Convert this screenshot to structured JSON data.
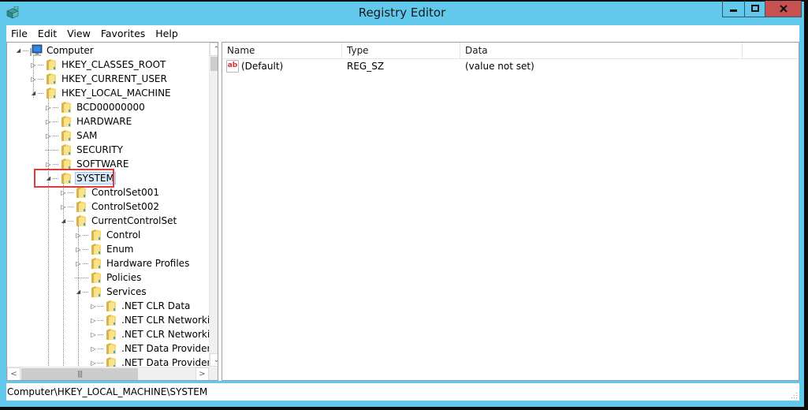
{
  "window": {
    "title": "Registry Editor",
    "accent_color": "#62c9ec",
    "close_color": "#c75050",
    "buttons": {
      "minimize": "minimize-icon",
      "maximize": "maximize-icon",
      "close": "close-icon"
    }
  },
  "menu": {
    "items": [
      {
        "label": "File"
      },
      {
        "label": "Edit"
      },
      {
        "label": "View"
      },
      {
        "label": "Favorites"
      },
      {
        "label": "Help"
      }
    ]
  },
  "tree": {
    "nodes": [
      {
        "label": "Computer",
        "level": 0,
        "expander": "expanded",
        "icon": "computer-icon"
      },
      {
        "label": "HKEY_CLASSES_ROOT",
        "level": 1,
        "expander": "collapsed",
        "icon": "folder-icon"
      },
      {
        "label": "HKEY_CURRENT_USER",
        "level": 1,
        "expander": "collapsed",
        "icon": "folder-icon"
      },
      {
        "label": "HKEY_LOCAL_MACHINE",
        "level": 1,
        "expander": "expanded",
        "icon": "folder-icon"
      },
      {
        "label": "BCD00000000",
        "level": 2,
        "expander": "collapsed",
        "icon": "folder-icon"
      },
      {
        "label": "HARDWARE",
        "level": 2,
        "expander": "collapsed",
        "icon": "folder-icon"
      },
      {
        "label": "SAM",
        "level": 2,
        "expander": "collapsed",
        "icon": "folder-icon"
      },
      {
        "label": "SECURITY",
        "level": 2,
        "expander": "none",
        "icon": "folder-icon"
      },
      {
        "label": "SOFTWARE",
        "level": 2,
        "expander": "collapsed",
        "icon": "folder-icon"
      },
      {
        "label": "SYSTEM",
        "level": 2,
        "expander": "expanded",
        "icon": "folder-icon",
        "selected": true
      },
      {
        "label": "ControlSet001",
        "level": 3,
        "expander": "collapsed",
        "icon": "folder-icon"
      },
      {
        "label": "ControlSet002",
        "level": 3,
        "expander": "collapsed",
        "icon": "folder-icon"
      },
      {
        "label": "CurrentControlSet",
        "level": 3,
        "expander": "expanded",
        "icon": "folder-icon"
      },
      {
        "label": "Control",
        "level": 4,
        "expander": "collapsed",
        "icon": "folder-icon"
      },
      {
        "label": "Enum",
        "level": 4,
        "expander": "collapsed",
        "icon": "folder-icon"
      },
      {
        "label": "Hardware Profiles",
        "level": 4,
        "expander": "collapsed",
        "icon": "folder-icon"
      },
      {
        "label": "Policies",
        "level": 4,
        "expander": "none",
        "icon": "folder-icon"
      },
      {
        "label": "Services",
        "level": 4,
        "expander": "expanded",
        "icon": "folder-icon"
      },
      {
        "label": ".NET CLR Data",
        "level": 5,
        "expander": "collapsed",
        "icon": "folder-icon"
      },
      {
        "label": ".NET CLR Networking",
        "level": 5,
        "expander": "collapsed",
        "icon": "folder-icon"
      },
      {
        "label": ".NET CLR Networking",
        "level": 5,
        "expander": "collapsed",
        "icon": "folder-icon"
      },
      {
        "label": ".NET Data Provider fo",
        "level": 5,
        "expander": "collapsed",
        "icon": "folder-icon"
      },
      {
        "label": ".NET Data Provider fo",
        "level": 5,
        "expander": "collapsed",
        "icon": "folder-icon"
      }
    ],
    "highlight_color": "#e23b3b"
  },
  "values": {
    "columns": [
      "Name",
      "Type",
      "Data"
    ],
    "rows": [
      {
        "name": "(Default)",
        "type": "REG_SZ",
        "data": "(value not set)",
        "icon": "string-value-icon",
        "icon_text": "ab"
      }
    ]
  },
  "status": {
    "path": "Computer\\HKEY_LOCAL_MACHINE\\SYSTEM"
  }
}
